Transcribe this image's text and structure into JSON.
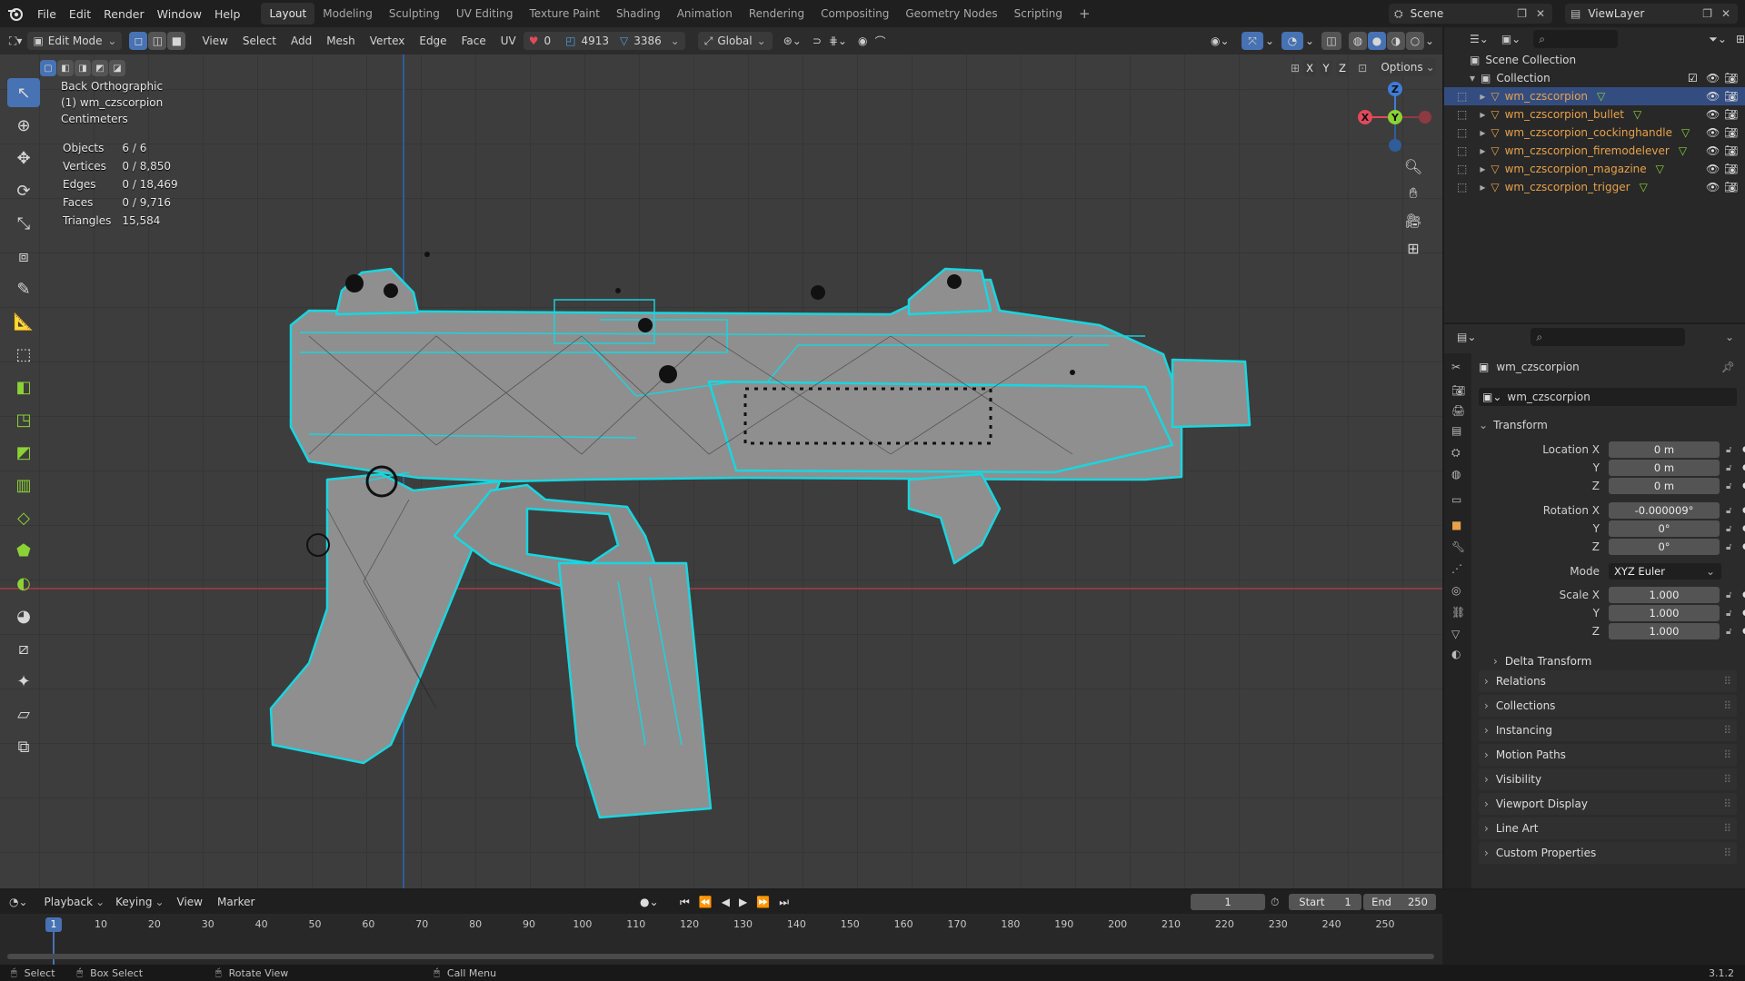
{
  "menu": [
    "File",
    "Edit",
    "Render",
    "Window",
    "Help"
  ],
  "workspaces": [
    "Layout",
    "Modeling",
    "Sculpting",
    "UV Editing",
    "Texture Paint",
    "Shading",
    "Animation",
    "Rendering",
    "Compositing",
    "Geometry Nodes",
    "Scripting"
  ],
  "active_workspace": "Layout",
  "scene_name": "Scene",
  "view_layer": "ViewLayer",
  "viewport_header": {
    "mode": "Edit Mode",
    "menus": [
      "View",
      "Select",
      "Add",
      "Mesh",
      "Vertex",
      "Edge",
      "Face",
      "UV"
    ],
    "counter_red": "0",
    "counter_edges": "4913",
    "counter_faces": "3386",
    "orientation": "Global",
    "options_label": "Options",
    "axes": [
      "X",
      "Y",
      "Z"
    ]
  },
  "overlay_info": {
    "view_name": "Back Orthographic",
    "object_name": "(1) wm_czscorpion",
    "units": "Centimeters"
  },
  "stats": [
    {
      "label": "Objects",
      "value": "6 / 6"
    },
    {
      "label": "Vertices",
      "value": "0 / 8,850"
    },
    {
      "label": "Edges",
      "value": "0 / 18,469"
    },
    {
      "label": "Faces",
      "value": "0 / 9,716"
    },
    {
      "label": "Triangles",
      "value": "15,584"
    }
  ],
  "gizmo": {
    "x": "X",
    "y": "Y",
    "z": "Z"
  },
  "outliner": {
    "root": "Scene Collection",
    "collection": "Collection",
    "objects": [
      "wm_czscorpion",
      "wm_czscorpion_bullet",
      "wm_czscorpion_cockinghandle",
      "wm_czscorpion_firemodelever",
      "wm_czscorpion_magazine",
      "wm_czscorpion_trigger"
    ]
  },
  "properties": {
    "object_name": "wm_czscorpion",
    "data_name": "wm_czscorpion",
    "transform_label": "Transform",
    "location_label": "Location X",
    "location": [
      "0 m",
      "0 m",
      "0 m"
    ],
    "rotation_label": "Rotation X",
    "rotation": [
      "-0.000009°",
      "0°",
      "0°"
    ],
    "mode_label": "Mode",
    "mode_value": "XYZ Euler",
    "scale_label": "Scale X",
    "scale": [
      "1.000",
      "1.000",
      "1.000"
    ],
    "y_label": "Y",
    "z_label": "Z",
    "subpanels": [
      "Delta Transform",
      "Relations",
      "Collections",
      "Instancing",
      "Motion Paths",
      "Visibility",
      "Viewport Display",
      "Line Art",
      "Custom Properties"
    ]
  },
  "timeline": {
    "menus": [
      "Playback",
      "Keying",
      "View",
      "Marker"
    ],
    "current_frame": "1",
    "start_label": "Start",
    "start": "1",
    "end_label": "End",
    "end": "250",
    "ticks": [
      "1",
      "10",
      "20",
      "30",
      "40",
      "50",
      "60",
      "70",
      "80",
      "90",
      "100",
      "110",
      "120",
      "130",
      "140",
      "150",
      "160",
      "170",
      "180",
      "190",
      "200",
      "210",
      "220",
      "230",
      "240",
      "250"
    ]
  },
  "statusbar": {
    "select": "Select",
    "box_select": "Box Select",
    "rotate_view": "Rotate View",
    "call_menu": "Call Menu",
    "version": "3.1.2"
  },
  "colors": {
    "accent": "#4772b3",
    "mesh_edge": "#19d6e0",
    "object_name": "#e8a14a",
    "x_axis": "#e04a5a",
    "y_axis": "#8bd235",
    "z_axis": "#3d7dd8"
  }
}
